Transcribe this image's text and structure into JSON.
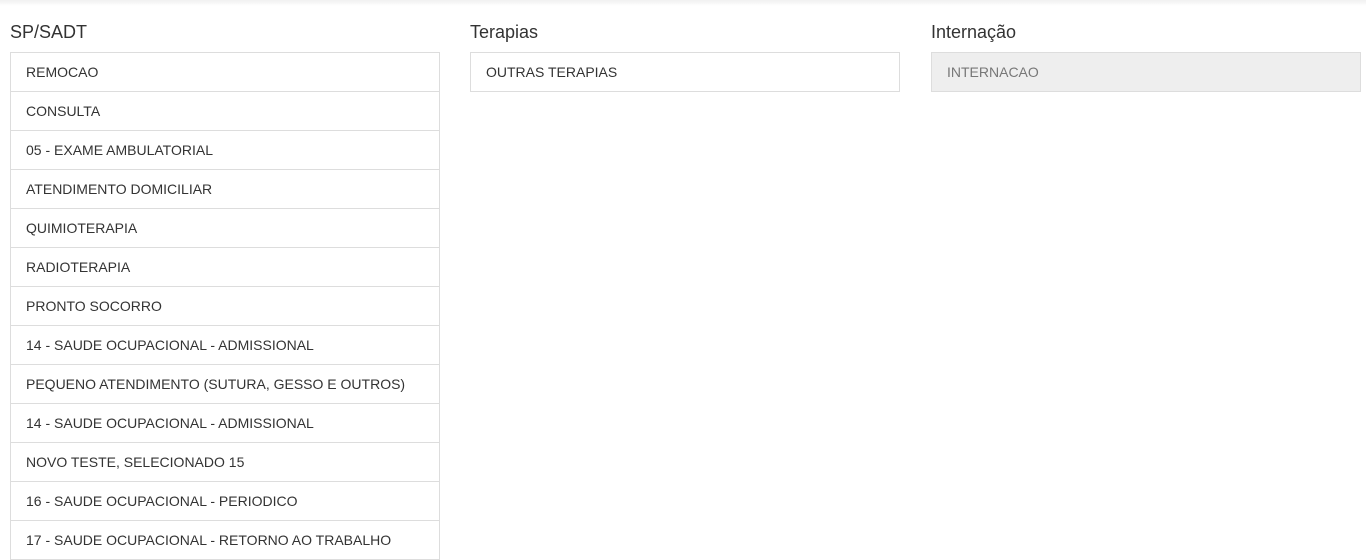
{
  "columns": {
    "sp_sadt": {
      "title": "SP/SADT",
      "items": [
        "REMOCAO",
        "CONSULTA",
        "05 - EXAME AMBULATORIAL",
        "ATENDIMENTO DOMICILIAR",
        "QUIMIOTERAPIA",
        "RADIOTERAPIA",
        "PRONTO SOCORRO",
        "14 - SAUDE OCUPACIONAL - ADMISSIONAL",
        "PEQUENO ATENDIMENTO (SUTURA, GESSO E OUTROS)",
        "14 - SAUDE OCUPACIONAL - ADMISSIONAL",
        "NOVO TESTE, SELECIONADO 15",
        "16 - SAUDE OCUPACIONAL - PERIODICO",
        "17 - SAUDE OCUPACIONAL - RETORNO AO TRABALHO"
      ]
    },
    "terapias": {
      "title": "Terapias",
      "items": [
        "OUTRAS TERAPIAS"
      ]
    },
    "internacao": {
      "title": "Internação",
      "items": [
        "INTERNACAO"
      ],
      "disabled": true
    }
  },
  "colors": {
    "border": "#dddddd",
    "disabled_bg": "#eeeeee",
    "text": "#333333"
  }
}
